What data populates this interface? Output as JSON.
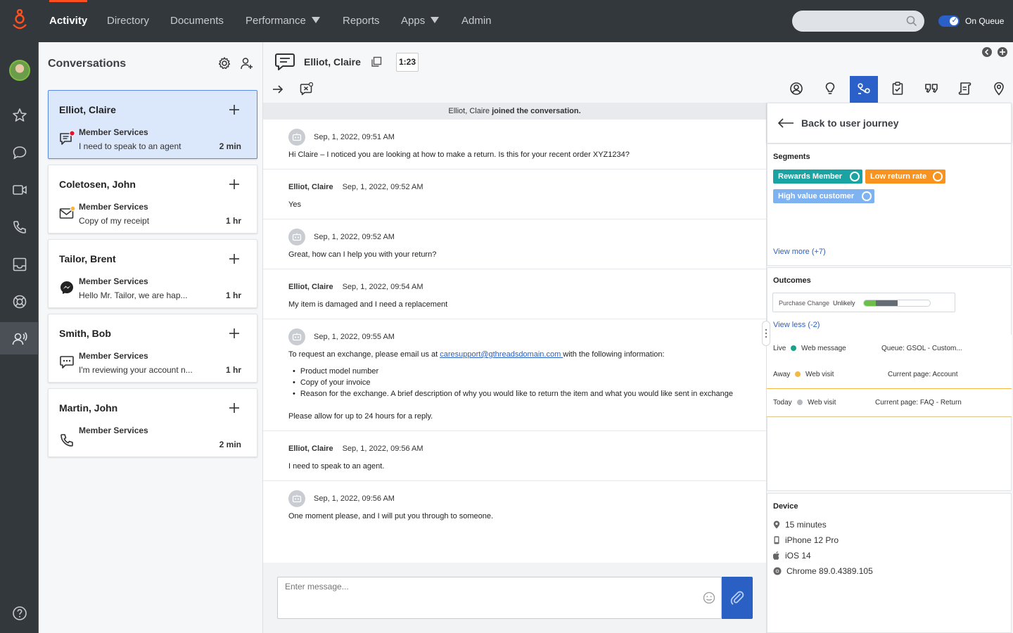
{
  "nav": {
    "items": [
      {
        "label": "Activity",
        "active": true
      },
      {
        "label": "Directory"
      },
      {
        "label": "Documents"
      },
      {
        "label": "Performance",
        "dropdown": true
      },
      {
        "label": "Reports"
      },
      {
        "label": "Apps",
        "dropdown": true
      },
      {
        "label": "Admin"
      }
    ],
    "queue_label": "On Queue",
    "queue_on": true
  },
  "conversations": {
    "title": "Conversations",
    "items": [
      {
        "name": "Elliot, Claire",
        "queue": "Member Services",
        "message": "I need to speak to an agent",
        "time": "2 min",
        "channel": "chat-icon",
        "selected": true
      },
      {
        "name": "Coletosen, John",
        "queue": "Member Services",
        "message": "Copy of my receipt",
        "time": "1 hr",
        "channel": "email-icon"
      },
      {
        "name": "Tailor, Brent",
        "queue": "Member Services",
        "message": "Hello Mr. Tailor, we are hap...",
        "time": "1 hr",
        "channel": "messenger-icon"
      },
      {
        "name": "Smith, Bob",
        "queue": "Member Services",
        "message": "I'm reviewing your account n...",
        "time": "1 hr",
        "channel": "sms-icon"
      },
      {
        "name": "Martin, John",
        "queue": "Member Services",
        "message": "",
        "time": "2 min",
        "channel": "phone-icon"
      }
    ]
  },
  "chat": {
    "participant": "Elliot, Claire",
    "timer": "1:23",
    "joined_name": "Elliot, Claire",
    "joined_text": " joined the conversation.",
    "messages": [
      {
        "sender": "",
        "time": "Sep, 1, 2022, 09:51 AM",
        "text": "Hi Claire – I noticed you are looking at how to make a return. Is this for your recent order XYZ1234?"
      },
      {
        "sender": "Elliot, Claire",
        "time": "Sep, 1, 2022, 09:52 AM",
        "text": "Yes"
      },
      {
        "sender": "",
        "time": "Sep, 1, 2022, 09:52 AM",
        "text": "Great, how can I help you with your return?"
      },
      {
        "sender": "Elliot, Claire",
        "time": "Sep, 1, 2022, 09:54 AM",
        "text": "My item is damaged and I need a replacement"
      },
      {
        "sender": "",
        "time": "Sep, 1, 2022, 09:55 AM",
        "text_pre": "To request an exchange, please email us at ",
        "link": "caresupport@gthreadsdomain.com ",
        "text_post": "with the following information:",
        "bullets": [
          "Product model number",
          "Copy of your invoice",
          "Reason for the exchange. A brief description of why you would like to return the item and what you would like sent in exchange"
        ],
        "footer": "Please allow for up to 24 hours for a reply."
      },
      {
        "sender": "Elliot, Claire",
        "time": "Sep, 1, 2022, 09:56 AM",
        "text": "I need to speak to an agent."
      },
      {
        "sender": "",
        "time": "Sep, 1, 2022, 09:56 AM",
        "text": "One moment please, and I will put you through to someone."
      }
    ],
    "compose_placeholder": "Enter message..."
  },
  "journey": {
    "back_label": "Back to user journey",
    "segments_title": "Segments",
    "segments": [
      {
        "label": "Rewards Member",
        "color": "#1aa3a3"
      },
      {
        "label": "Low return rate",
        "color": "#f7931e"
      },
      {
        "label": "High value customer",
        "color": "#7fb2f0"
      }
    ],
    "view_more": "View more (+7)",
    "outcomes_title": "Outcomes",
    "outcome": {
      "label": "Purchase Change",
      "value": "Unlikely",
      "fill_green": 0.18,
      "fill_gray": 0.33
    },
    "view_less": "View less (-2)",
    "timeline": [
      {
        "when": "Live",
        "type": "Web message",
        "detail": "Queue: GSOL - Custom...",
        "color": "#1aa38a"
      },
      {
        "when": "Away",
        "type": "Web visit",
        "detail": "Current page: Account",
        "color": "#f5b942"
      },
      {
        "when": "Today",
        "type": "Web visit",
        "detail": "Current page: FAQ - Return",
        "color": "#b5b9be"
      }
    ],
    "device_title": "Device",
    "device": [
      {
        "icon": "location-icon",
        "text": "15 minutes"
      },
      {
        "icon": "phone-device-icon",
        "text": "iPhone 12 Pro"
      },
      {
        "icon": "apple-icon",
        "text": "iOS 14"
      },
      {
        "icon": "chrome-icon",
        "text": "Chrome 89.0.4389.105"
      }
    ]
  }
}
